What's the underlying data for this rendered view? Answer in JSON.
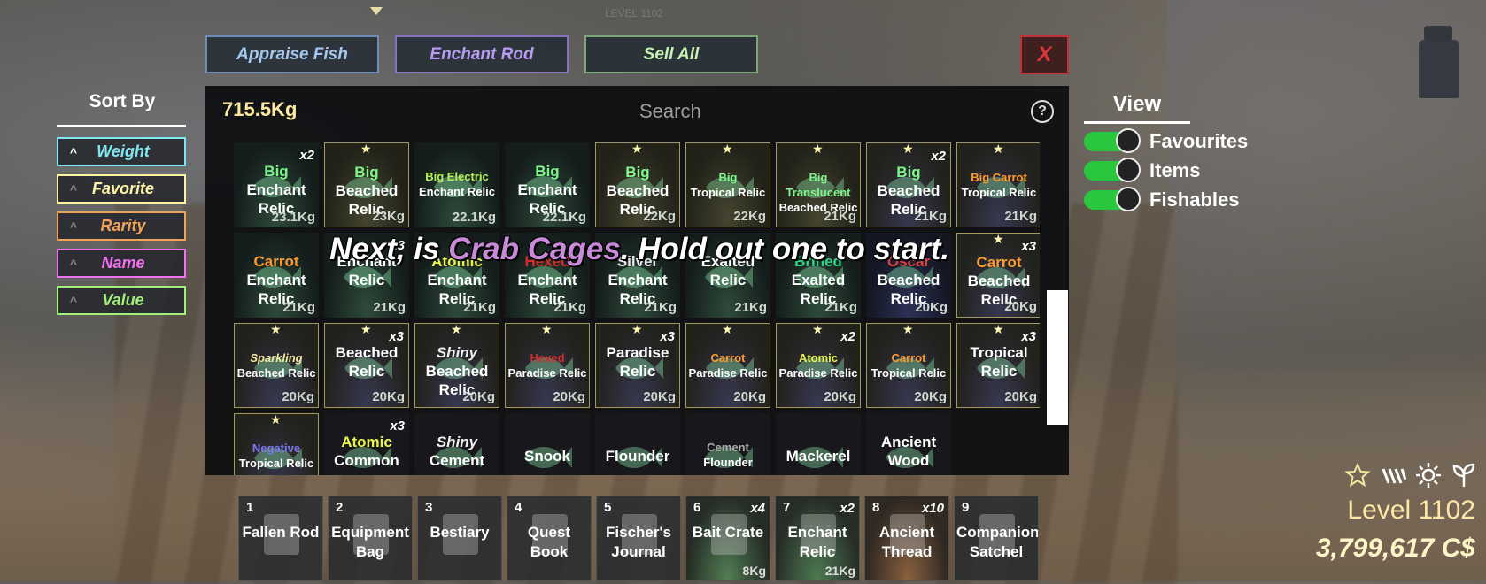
{
  "background": {
    "player_level_tag": "LEVEL 1102"
  },
  "top_buttons": {
    "appraise": "Appraise Fish",
    "enchant": "Enchant Rod",
    "sell": "Sell All",
    "close": "X"
  },
  "sort": {
    "title": "Sort By",
    "options": [
      {
        "label": "Weight",
        "color": "#7fe7f1",
        "active": true
      },
      {
        "label": "Favorite",
        "color": "#fff2a2",
        "active": false
      },
      {
        "label": "Rarity",
        "color": "#f2a35a",
        "active": false
      },
      {
        "label": "Name",
        "color": "#ef72f0",
        "active": false
      },
      {
        "label": "Value",
        "color": "#a2f07a",
        "active": false
      }
    ]
  },
  "view": {
    "title": "View",
    "toggles": [
      {
        "label": "Favourites",
        "on": true
      },
      {
        "label": "Items",
        "on": true
      },
      {
        "label": "Fishables",
        "on": true
      }
    ]
  },
  "panel": {
    "total_weight": "715.5Kg",
    "search_placeholder": "Search",
    "help": "?"
  },
  "tutorial": {
    "pre": "Next, is ",
    "highlight": "Crab Cages",
    "post": ". Hold out one to start."
  },
  "inventory": [
    {
      "mut": "Big",
      "mutClass": "m-big",
      "name": "Enchant Relic",
      "qty": "x2",
      "weight": "23.1Kg",
      "fav": false,
      "tone": "green"
    },
    {
      "mut": "Big",
      "mutClass": "m-big",
      "name": "Beached Relic",
      "qty": "",
      "weight": "23Kg",
      "fav": true,
      "tone": "green"
    },
    {
      "mut": "Big Electric",
      "mutClass": "m-electric",
      "name": "Enchant Relic",
      "qty": "",
      "weight": "22.1Kg",
      "fav": false,
      "tone": "green",
      "small": true
    },
    {
      "mut": "Big",
      "mutClass": "m-big",
      "name": "Enchant Relic",
      "qty": "",
      "weight": "22.1Kg",
      "fav": false,
      "tone": "green"
    },
    {
      "mut": "Big",
      "mutClass": "m-big",
      "name": "Beached Relic",
      "qty": "",
      "weight": "22Kg",
      "fav": true,
      "tone": "green"
    },
    {
      "mut": "Big",
      "mutClass": "m-big",
      "name": "Tropical Relic",
      "qty": "",
      "weight": "22Kg",
      "fav": true,
      "tone": "green",
      "small": true
    },
    {
      "mut": "Big Translucent",
      "mutClass": "m-translucent",
      "name": "Beached Relic",
      "qty": "",
      "weight": "21Kg",
      "fav": true,
      "tone": "green",
      "small": true
    },
    {
      "mut": "Big",
      "mutClass": "m-big",
      "name": "Beached Relic",
      "qty": "x2",
      "weight": "21Kg",
      "fav": true,
      "tone": "blue"
    },
    {
      "mut": "Big Carrot",
      "mutClass": "m-carrot",
      "name": "Tropical Relic",
      "qty": "",
      "weight": "21Kg",
      "fav": true,
      "tone": "blue",
      "small": true
    },
    {
      "mut": "Carrot",
      "mutClass": "m-carrot",
      "name": "Enchant Relic",
      "qty": "",
      "weight": "21Kg",
      "fav": false,
      "tone": "green"
    },
    {
      "mut": "",
      "mutClass": "",
      "name": "Enchant Relic",
      "qty": "x3",
      "weight": "21Kg",
      "fav": false,
      "tone": "green"
    },
    {
      "mut": "Atomic",
      "mutClass": "m-atomic",
      "name": "Enchant Relic",
      "qty": "",
      "weight": "21Kg",
      "fav": false,
      "tone": "green"
    },
    {
      "mut": "Hexed",
      "mutClass": "m-hexed",
      "name": "Enchant Relic",
      "qty": "",
      "weight": "21Kg",
      "fav": false,
      "tone": "green"
    },
    {
      "mut": "Silver",
      "mutClass": "m-silver",
      "name": "Enchant Relic",
      "qty": "",
      "weight": "21Kg",
      "fav": false,
      "tone": "green"
    },
    {
      "mut": "",
      "mutClass": "",
      "name": "Exalted Relic",
      "qty": "",
      "weight": "21Kg",
      "fav": false,
      "tone": "green"
    },
    {
      "mut": "Brined",
      "mutClass": "m-brined",
      "name": "Exalted Relic",
      "qty": "",
      "weight": "21Kg",
      "fav": false,
      "tone": "green"
    },
    {
      "mut": "Oscar",
      "mutClass": "m-oscar",
      "name": "Beached Relic",
      "qty": "",
      "weight": "20Kg",
      "fav": false,
      "tone": "blue"
    },
    {
      "mut": "Carrot",
      "mutClass": "m-carrot",
      "name": "Beached Relic",
      "qty": "x3",
      "weight": "20Kg",
      "fav": true,
      "tone": "blue"
    },
    {
      "mut": "Sparkling",
      "mutClass": "m-sparkling",
      "name": "Beached Relic",
      "qty": "",
      "weight": "20Kg",
      "fav": true,
      "tone": "blue",
      "small": true
    },
    {
      "mut": "",
      "mutClass": "",
      "name": "Beached Relic",
      "qty": "x3",
      "weight": "20Kg",
      "fav": true,
      "tone": "blue"
    },
    {
      "mut": "Shiny",
      "mutClass": "m-shiny",
      "name": "Beached Relic",
      "qty": "",
      "weight": "20Kg",
      "fav": true,
      "tone": "blue"
    },
    {
      "mut": "Hexed",
      "mutClass": "m-hexed",
      "name": "Paradise Relic",
      "qty": "",
      "weight": "20Kg",
      "fav": true,
      "tone": "blue",
      "small": true
    },
    {
      "mut": "",
      "mutClass": "",
      "name": "Paradise Relic",
      "qty": "x3",
      "weight": "20Kg",
      "fav": true,
      "tone": "blue"
    },
    {
      "mut": "Carrot",
      "mutClass": "m-carrot",
      "name": "Paradise Relic",
      "qty": "",
      "weight": "20Kg",
      "fav": true,
      "tone": "blue",
      "small": true
    },
    {
      "mut": "Atomic",
      "mutClass": "m-atomic",
      "name": "Paradise Relic",
      "qty": "x2",
      "weight": "20Kg",
      "fav": true,
      "tone": "blue",
      "small": true
    },
    {
      "mut": "Carrot",
      "mutClass": "m-carrot",
      "name": "Tropical Relic",
      "qty": "",
      "weight": "20Kg",
      "fav": true,
      "tone": "blue",
      "small": true
    },
    {
      "mut": "",
      "mutClass": "",
      "name": "Tropical Relic",
      "qty": "x3",
      "weight": "20Kg",
      "fav": true,
      "tone": "blue"
    },
    {
      "mut": "Negative",
      "mutClass": "m-negative",
      "name": "Tropical Relic",
      "qty": "",
      "weight": "",
      "fav": true,
      "tone": "blue",
      "small": true
    },
    {
      "mut": "Atomic",
      "mutClass": "m-atomic",
      "name": "Common",
      "qty": "x3",
      "weight": "",
      "fav": false,
      "tone": "plain"
    },
    {
      "mut": "Shiny",
      "mutClass": "m-shiny",
      "name": "Cement",
      "qty": "",
      "weight": "",
      "fav": false,
      "tone": "plain"
    },
    {
      "mut": "",
      "mutClass": "",
      "name": "Snook",
      "qty": "",
      "weight": "",
      "fav": false,
      "tone": "plain",
      "low": true
    },
    {
      "mut": "",
      "mutClass": "",
      "name": "Flounder",
      "qty": "",
      "weight": "",
      "fav": false,
      "tone": "plain",
      "low": true
    },
    {
      "mut": "Cement",
      "mutClass": "m-cement",
      "name": "Flounder",
      "qty": "",
      "weight": "",
      "fav": false,
      "tone": "plain",
      "small": true
    },
    {
      "mut": "",
      "mutClass": "",
      "name": "Mackerel",
      "qty": "",
      "weight": "",
      "fav": false,
      "tone": "plain",
      "low": true
    },
    {
      "mut": "",
      "mutClass": "",
      "name": "Ancient Wood",
      "qty": "",
      "weight": "",
      "fav": false,
      "tone": "plain"
    }
  ],
  "hotbar": [
    {
      "num": "1",
      "name": "Fallen Rod",
      "qty": "",
      "weight": "",
      "tone": ""
    },
    {
      "num": "2",
      "name": "Equipment Bag",
      "qty": "",
      "weight": "",
      "tone": ""
    },
    {
      "num": "3",
      "name": "Bestiary",
      "qty": "",
      "weight": "",
      "tone": ""
    },
    {
      "num": "4",
      "name": "Quest Book",
      "qty": "",
      "weight": "",
      "tone": ""
    },
    {
      "num": "5",
      "name": "Fischer's Journal",
      "qty": "",
      "weight": "",
      "tone": ""
    },
    {
      "num": "6",
      "name": "Bait Crate",
      "qty": "x4",
      "weight": "8Kg",
      "tone": "green"
    },
    {
      "num": "7",
      "name": "Enchant Relic",
      "qty": "x2",
      "weight": "21Kg",
      "tone": "green"
    },
    {
      "num": "8",
      "name": "Ancient Thread",
      "qty": "x10",
      "weight": "",
      "tone": "brown"
    },
    {
      "num": "9",
      "name": "Companion Satchel",
      "qty": "",
      "weight": "",
      "tone": ""
    }
  ],
  "hud": {
    "icons": [
      "star-icon",
      "weather-icon",
      "sun-icon",
      "sprout-icon"
    ],
    "level": "Level 1102",
    "money": "3,799,617 C$"
  }
}
